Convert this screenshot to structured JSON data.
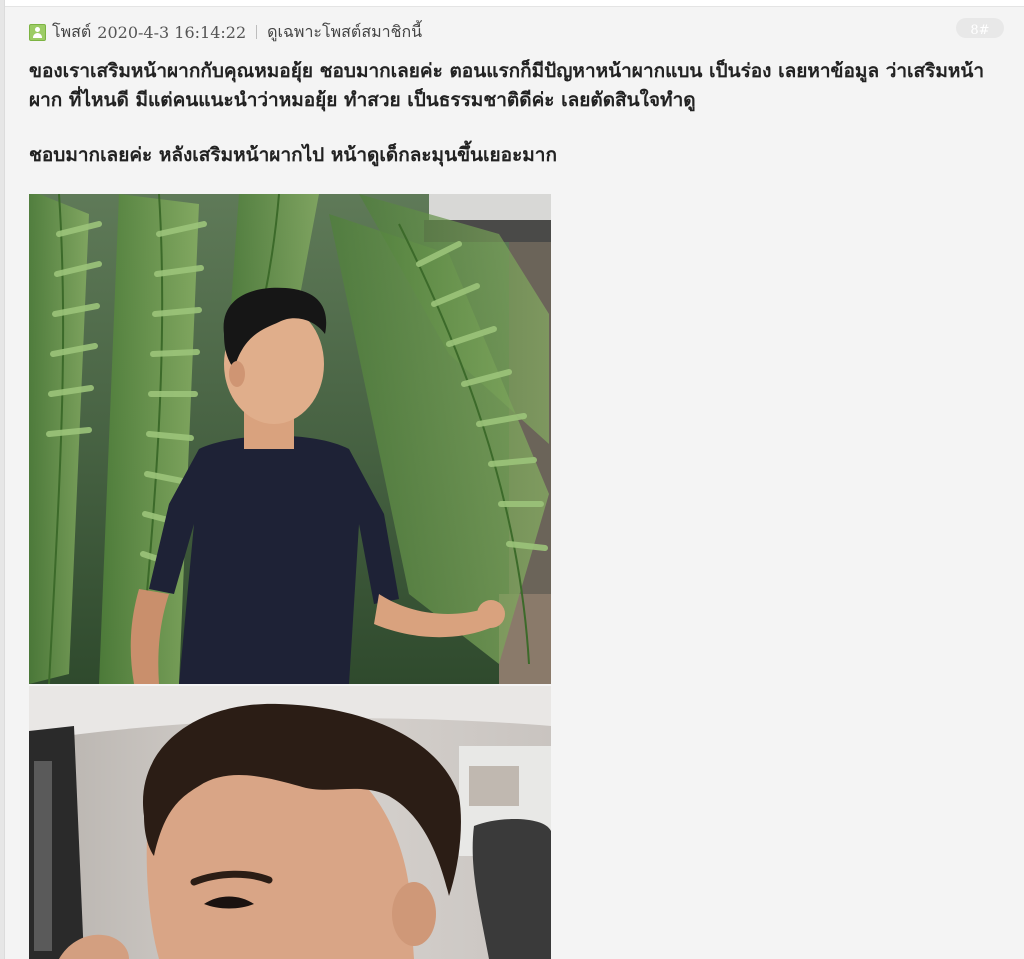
{
  "header": {
    "label": "โพสต์",
    "datetime": "2020-4-3 16:14:22",
    "filter_link": "ดูเฉพาะโพสต์สมาชิกนี้",
    "floor": "8#"
  },
  "post": {
    "paragraph_1": "ของเราเสริมหน้าผากกับคุณหมอยุ้ย ชอบมากเลยค่ะ ตอนแรกก็มีปัญหาหน้าผากแบน เป็นร่อง เลยหาข้อมูล ว่าเสริมหน้าผาก ที่ไหนดี มีแต่คนแนะนำว่าหมอยุ้ย ทำสวย เป็นธรรมชาติดีค่ะ เลยตัดสินใจทำดู",
    "paragraph_2": "ชอบมากเลยค่ะ หลังเสริมหน้าผากไป หน้าดูเด็กละมุนขึ้นเยอะมาก"
  },
  "images": [
    {
      "name": "photo-man-with-fern-leaves"
    },
    {
      "name": "photo-selfie-in-car"
    }
  ],
  "colors": {
    "background": "#f4f4f4",
    "text": "#222222",
    "icon_green": "#9ccc65"
  }
}
